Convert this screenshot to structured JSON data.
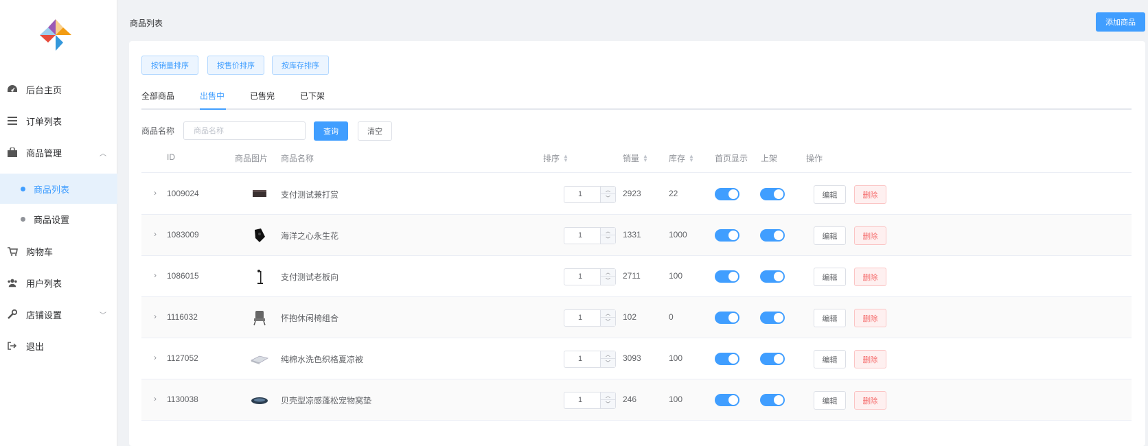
{
  "sidebar": {
    "items": [
      {
        "label": "后台主页",
        "icon": "dashboard-icon"
      },
      {
        "label": "订单列表",
        "icon": "list-icon"
      },
      {
        "label": "商品管理",
        "icon": "shopping-bag-icon"
      },
      {
        "label": "购物车",
        "icon": "cart-icon"
      },
      {
        "label": "用户列表",
        "icon": "users-icon"
      },
      {
        "label": "店铺设置",
        "icon": "wrench-icon"
      },
      {
        "label": "退出",
        "icon": "logout-icon"
      }
    ],
    "submenu": [
      {
        "label": "商品列表",
        "active": true
      },
      {
        "label": "商品设置",
        "active": false
      }
    ]
  },
  "header": {
    "breadcrumb": "商品列表",
    "add_button": "添加商品"
  },
  "sort_buttons": [
    "按销量排序",
    "按售价排序",
    "按库存排序"
  ],
  "tabs": [
    {
      "label": "全部商品",
      "active": false
    },
    {
      "label": "出售中",
      "active": true
    },
    {
      "label": "已售完",
      "active": false
    },
    {
      "label": "已下架",
      "active": false
    }
  ],
  "search": {
    "label": "商品名称",
    "placeholder": "商品名称",
    "query_button": "查询",
    "clear_button": "清空"
  },
  "table": {
    "columns": {
      "id": "ID",
      "image": "商品图片",
      "name": "商品名称",
      "sort": "排序",
      "sales": "销量",
      "stock": "库存",
      "home_display": "首页显示",
      "on_shelf": "上架",
      "actions": "操作"
    },
    "edit_label": "编辑",
    "delete_label": "删除",
    "rows": [
      {
        "id": "1009024",
        "name": "支付测试兼打赏",
        "sort": "1",
        "sales": "2923",
        "stock": "22",
        "home_display": true,
        "on_shelf": true,
        "image": "box-thumbnail"
      },
      {
        "id": "1083009",
        "name": "海洋之心永生花",
        "sort": "1",
        "sales": "1331",
        "stock": "1000",
        "home_display": true,
        "on_shelf": true,
        "image": "gift-box-thumbnail"
      },
      {
        "id": "1086015",
        "name": "支付测试老板向",
        "sort": "1",
        "sales": "2711",
        "stock": "100",
        "home_display": true,
        "on_shelf": true,
        "image": "lamp-thumbnail"
      },
      {
        "id": "1116032",
        "name": "怀抱休闲椅组合",
        "sort": "1",
        "sales": "102",
        "stock": "0",
        "home_display": true,
        "on_shelf": true,
        "image": "chair-thumbnail"
      },
      {
        "id": "1127052",
        "name": "纯棉水洗色织格夏凉被",
        "sort": "1",
        "sales": "3093",
        "stock": "100",
        "home_display": true,
        "on_shelf": true,
        "image": "blanket-thumbnail"
      },
      {
        "id": "1130038",
        "name": "贝壳型凉感蓬松宠物窝垫",
        "sort": "1",
        "sales": "246",
        "stock": "100",
        "home_display": true,
        "on_shelf": true,
        "image": "pet-bed-thumbnail"
      }
    ]
  },
  "colors": {
    "primary": "#409eff",
    "danger": "#f56c6c"
  }
}
